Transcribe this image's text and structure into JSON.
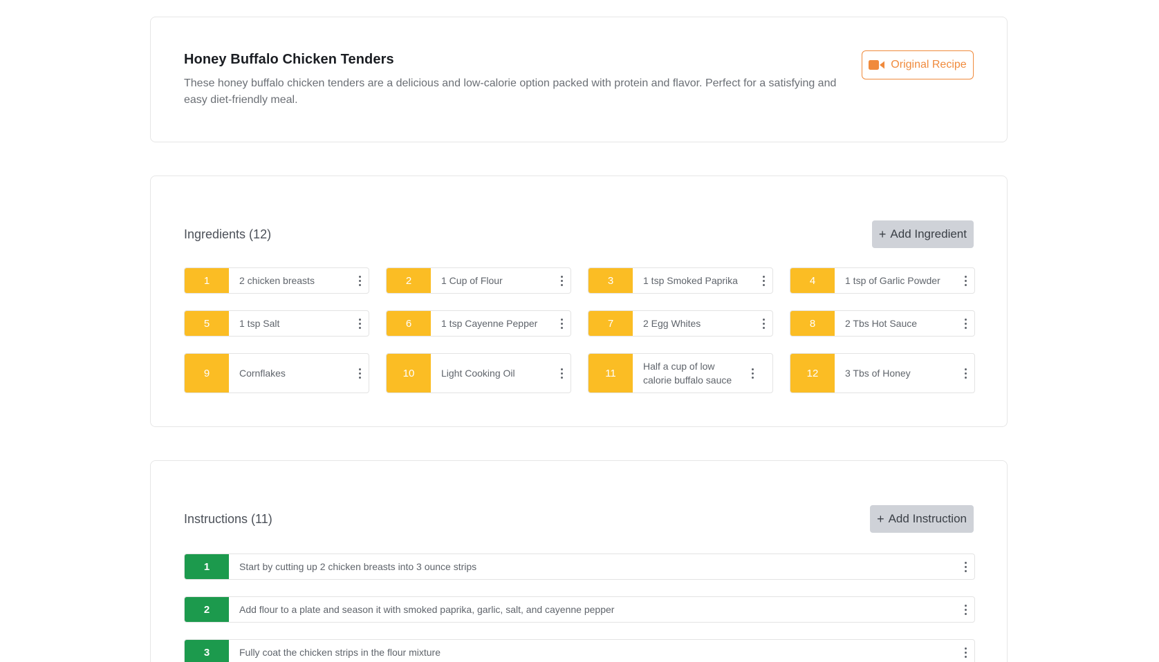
{
  "recipe": {
    "title": "Honey Buffalo Chicken Tenders",
    "description": "These honey buffalo chicken tenders are a delicious and low-calorie option packed with protein and flavor. Perfect for a satisfying and easy diet-friendly meal.",
    "original_button": "Original Recipe",
    "original_icon": "video-camera-icon"
  },
  "ingredients": {
    "title": "Ingredients (12)",
    "add_label": "Add Ingredient",
    "items": [
      {
        "num": "1",
        "text": "2 chicken breasts"
      },
      {
        "num": "2",
        "text": "1 Cup of Flour"
      },
      {
        "num": "3",
        "text": "1 tsp Smoked Paprika"
      },
      {
        "num": "4",
        "text": "1 tsp of Garlic Powder"
      },
      {
        "num": "5",
        "text": "1 tsp Salt"
      },
      {
        "num": "6",
        "text": "1 tsp Cayenne Pepper"
      },
      {
        "num": "7",
        "text": "2 Egg Whites"
      },
      {
        "num": "8",
        "text": "2 Tbs Hot Sauce"
      },
      {
        "num": "9",
        "text": "Cornflakes"
      },
      {
        "num": "10",
        "text": "Light Cooking Oil"
      },
      {
        "num": "11",
        "text": "Half a cup of low calorie buffalo sauce"
      },
      {
        "num": "12",
        "text": "3 Tbs of Honey"
      }
    ]
  },
  "instructions": {
    "title": "Instructions (11)",
    "add_label": "Add Instruction",
    "items": [
      {
        "num": "1",
        "text": "Start by cutting up 2 chicken breasts into 3 ounce strips"
      },
      {
        "num": "2",
        "text": "Add flour to a plate and season it with smoked paprika, garlic, salt, and cayenne pepper"
      },
      {
        "num": "3",
        "text": "Fully coat the chicken strips in the flour mixture"
      }
    ]
  },
  "colors": {
    "accent_orange": "#f08a3c",
    "ingredient_badge": "#fbbd24",
    "instruction_badge": "#1c9a4d",
    "add_button_bg": "#cfd2d8"
  }
}
